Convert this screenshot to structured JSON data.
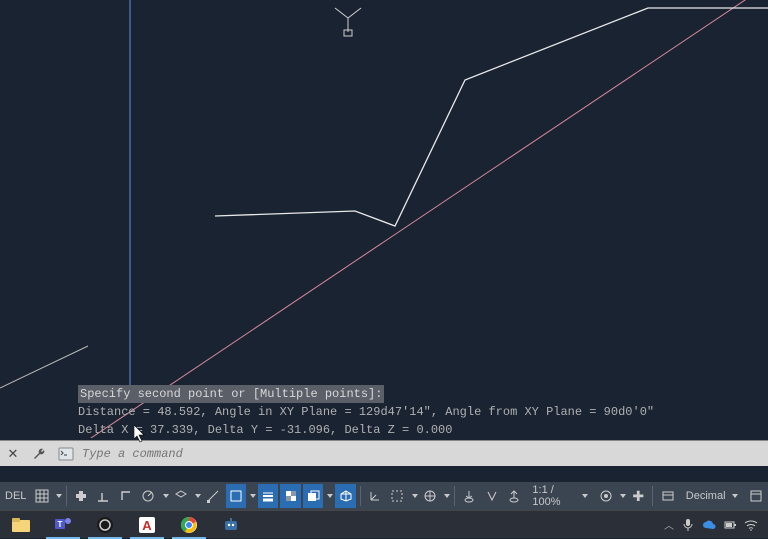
{
  "output": {
    "line1": "Specify second point or [Multiple points]:",
    "line2": "Distance = 48.592,  Angle in XY Plane = 129d47'14\",  Angle from XY Plane = 90d0'0\"",
    "line3": "Delta X = 37.339,  Delta Y = -31.096,   Delta Z = 0.000"
  },
  "command": {
    "placeholder": "Type a command"
  },
  "status": {
    "model_label": "DEL",
    "zoom": "1:1 / 100%",
    "units": "Decimal"
  },
  "taskbar": {
    "items": [
      "explorer",
      "teams",
      "obs",
      "autocad",
      "chrome",
      "robot"
    ]
  }
}
